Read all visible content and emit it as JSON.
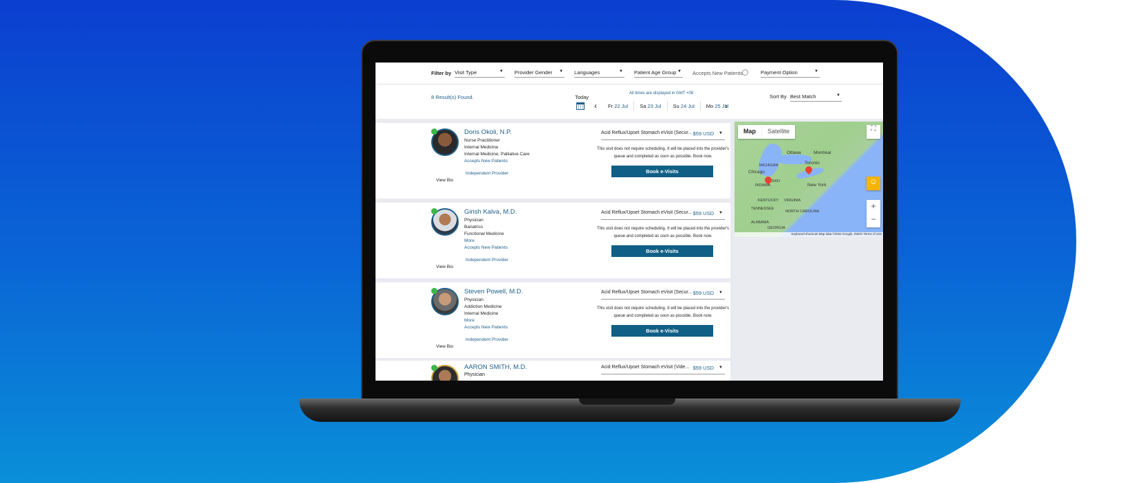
{
  "filters": {
    "label": "Filter by",
    "visit_type": "Visit Type",
    "provider_gender": "Provider Gender",
    "languages": "Languages",
    "patient_age_group": "Patient Age Group",
    "accepts_new_patients": "Accepts New Patients",
    "payment_option": "Payment Option"
  },
  "results": {
    "count": "8 Result(s) Found.",
    "timezone_note": "All times are displayed in GMT +08",
    "today": "Today",
    "sort_label": "Sort By",
    "sort_value": "Best Match",
    "dates": [
      {
        "day": "Fr",
        "date": "22 Jul"
      },
      {
        "day": "Sa",
        "date": "23 Jul"
      },
      {
        "day": "Su",
        "date": "24 Jul"
      },
      {
        "day": "Mo",
        "date": "25 Jul"
      }
    ]
  },
  "providers": [
    {
      "name": "Doris Okoli, N.P.",
      "lines": [
        "Nurse Practitioner",
        "Internal Medicine",
        "Internal Medicine, Palliative Care"
      ],
      "accepts": "Accepts New Patients",
      "independent": "Independent Provider",
      "view_bio": "View Bio",
      "visit": "Acid Reflux/Upset Stomach eVisit (Secur...",
      "price": "$59 USD",
      "note": "This visit does not require scheduling. It will be placed into the provider's queue and completed as soon as possible. Book now.",
      "book": "Book e-Visits"
    },
    {
      "name": "Girish Kalva, M.D.",
      "lines": [
        "Physician",
        "Bariatrics",
        "Functional Medicine"
      ],
      "more": "More",
      "accepts": "Accepts New Patients",
      "independent": "Independent Provider",
      "view_bio": "View Bio",
      "visit": "Acid Reflux/Upset Stomach eVisit (Secur...",
      "price": "$59 USD",
      "note": "This visit does not require scheduling. It will be placed into the provider's queue and completed as soon as possible. Book now.",
      "book": "Book e-Visits"
    },
    {
      "name": "Steven Powell, M.D.",
      "lines": [
        "Physician",
        "Addiction Medicine",
        "Internal Medicine"
      ],
      "more": "More",
      "accepts": "Accepts New Patients",
      "independent": "Independent Provider",
      "view_bio": "View Bio",
      "visit": "Acid Reflux/Upset Stomach eVisit (Secur...",
      "price": "$59 USD",
      "note": "This visit does not require scheduling. It will be placed into the provider's queue and completed as soon as possible. Book now.",
      "book": "Book e-Visits"
    },
    {
      "name": "AARON SMITH, M.D.",
      "lines": [
        "Physician"
      ],
      "visit": "Acid Reflux/Upset Stomach eVisit (Vide...",
      "price": "$59 USD"
    }
  ],
  "map": {
    "tab_map": "Map",
    "tab_satellite": "Satellite",
    "footer": "Keyboard shortcuts   Map data ©2022 Google, INEGI   Terms of Use",
    "labels": [
      "Ottawa",
      "Montreal",
      "Toronto",
      "Chicago",
      "New York",
      "MICHIGAN",
      "OHIO",
      "INDIANA",
      "KENTUCKY",
      "VIRGINIA",
      "TENNESSEE",
      "NORTH CAROLINA",
      "GEORGIA",
      "ALABAMA"
    ]
  }
}
